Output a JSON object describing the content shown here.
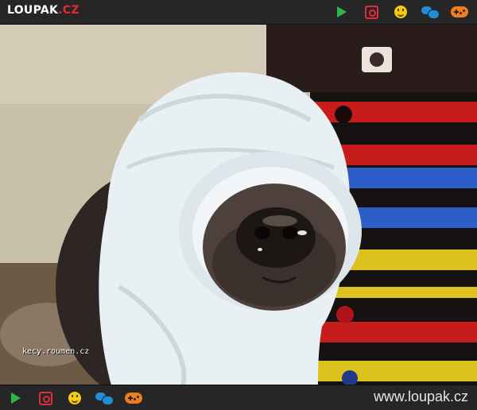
{
  "brand": {
    "part1": "LOUPAK",
    "part2": ".CZ"
  },
  "top_icons": [
    "play-icon",
    "instagram-icon",
    "smiley-icon",
    "chat-icon",
    "gamepad-icon"
  ],
  "bottom_icons": [
    "play-icon",
    "instagram-icon",
    "smiley-icon",
    "chat-icon",
    "gamepad-icon"
  ],
  "footer": {
    "site_url": "www.loupak.cz"
  },
  "photo": {
    "caption": "kecy.roumen.cz"
  },
  "colors": {
    "bar": "#262626",
    "play": "#2ab84a",
    "instagram": "#e02f3a",
    "smiley": "#f4cc16",
    "chat": "#1f8ed8",
    "gamepad": "#ef7c1d",
    "logo_accent": "#e32b2b"
  }
}
